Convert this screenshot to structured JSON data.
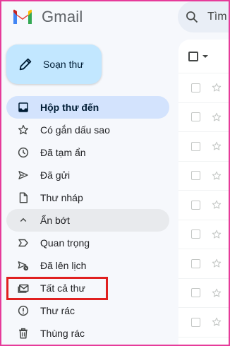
{
  "app": {
    "name": "Gmail"
  },
  "search": {
    "placeholder": "Tìm"
  },
  "compose": {
    "label": "Soạn thư"
  },
  "sidebar": {
    "items": [
      {
        "label": "Hộp thư đến",
        "icon": "inbox-icon",
        "active": true
      },
      {
        "label": "Có gắn dấu sao",
        "icon": "star-icon"
      },
      {
        "label": "Đã tạm ẩn",
        "icon": "clock-icon"
      },
      {
        "label": "Đã gửi",
        "icon": "send-icon"
      },
      {
        "label": "Thư nháp",
        "icon": "draft-icon"
      },
      {
        "label": "Ẩn bớt",
        "icon": "chevron-up-icon"
      },
      {
        "label": "Quan trọng",
        "icon": "important-icon"
      },
      {
        "label": "Đã lên lịch",
        "icon": "scheduled-send-icon"
      },
      {
        "label": "Tất cả thư",
        "icon": "all-mail-icon",
        "highlighted": true
      },
      {
        "label": "Thư rác",
        "icon": "spam-icon"
      },
      {
        "label": "Thùng rác",
        "icon": "trash-icon"
      }
    ]
  },
  "colors": {
    "active_bg": "#d3e3fd",
    "compose_bg": "#c2e7ff",
    "highlight_border": "#e02020",
    "frame_border": "#e63b9a"
  },
  "mail_list": {
    "row_count": 9
  }
}
